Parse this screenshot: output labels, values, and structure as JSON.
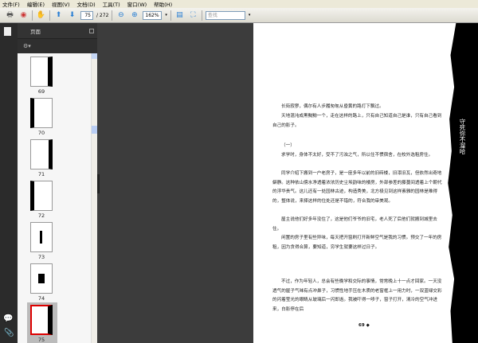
{
  "menu": [
    "文件(F)",
    "编辑(E)",
    "视图(V)",
    "文档(D)",
    "工具(T)",
    "窗口(W)",
    "帮助(H)"
  ],
  "toolbar": {
    "current_page": "75",
    "total_pages": "/ 272",
    "zoom": "162%",
    "search_placeholder": "查找"
  },
  "panel": {
    "title": "页面"
  },
  "thumbnails": [
    {
      "label": "69"
    },
    {
      "label": "70"
    },
    {
      "label": "71"
    },
    {
      "label": "72"
    },
    {
      "label": "73"
    },
    {
      "label": "74"
    },
    {
      "label": "75"
    }
  ],
  "page": {
    "paragraphs": [
      "长街寂寥，偶尔有人步履匆匆从昏黄的路灯下飘过。",
      "天地混沌成黑黝黝一个，走在这样的路上，只有自己知道自己是谁，只有自己看到自己的影子。",
      "（一）",
      "求学时，身体不太好，受不了污浊之气，所以住不惯宿舍，在校外选租房住。",
      "同学介绍下搬到一户老房子，是一座多年以前的旧砖楼，旧漆旧瓦，但依然出奇地僻静。这种依山傍水净透着浓浓历史尘埃韵味的楼房，外部参差的藤蔓间透着上个朝代的浮华贵气。这儿还有一处园林古迹，构造秀美，北方极见到这样素雅的园林是难得的，整体说，来择这样的住处还是不错的，符合我的审美观。",
      "屋主说他们好多年没住了，这是他们爷爷的旧宅，老人死了后他们就搬到城里去住。",
      "闲置的房子里有些异味，每天把开窗刷打开新鲜空气是我的习惯。预交了一年的房租，因为贪得合算，要知道，穷学生就要这样过日子。",
      "不过，作为年轻人，总会有些晚学和交际的事情，常常晚上十一点才回家。一天没透气的屋子气味有点冲鼻子，习惯性地手压在木质的老窗框上一用力时，一双蓝绿交彩的闪着莹光的眼睛从玻璃后一闪即逝。我被吓得一哆子，窗子打开，清冷的空气冲进来，白影停在后"
    ],
    "page_number": "69 ◆",
    "side_text": "守死你不溜哈"
  }
}
